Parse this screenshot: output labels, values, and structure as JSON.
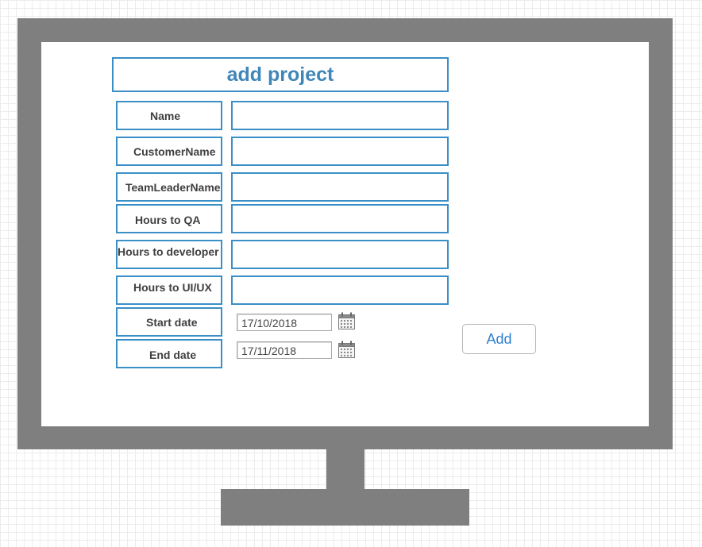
{
  "form": {
    "title": "add project",
    "fields": [
      {
        "label": "Name",
        "value": ""
      },
      {
        "label": "CustomerName",
        "value": ""
      },
      {
        "label": "TeamLeaderName",
        "value": ""
      },
      {
        "label": "Hours to QA",
        "value": ""
      },
      {
        "label": "Hours to developer",
        "value": ""
      },
      {
        "label": "Hours to UI/UX",
        "value": ""
      }
    ],
    "start_date": {
      "label": "Start date",
      "value": "17/10/2018",
      "icon": "calendar-icon"
    },
    "end_date": {
      "label": "End date",
      "value": "17/11/2018",
      "icon": "calendar-icon"
    },
    "submit_label": "Add"
  },
  "colors": {
    "accent": "#3a8fc7",
    "title_text": "#3f86b9",
    "button_text": "#2f7fd0",
    "monitor": "#7f7f7f"
  }
}
